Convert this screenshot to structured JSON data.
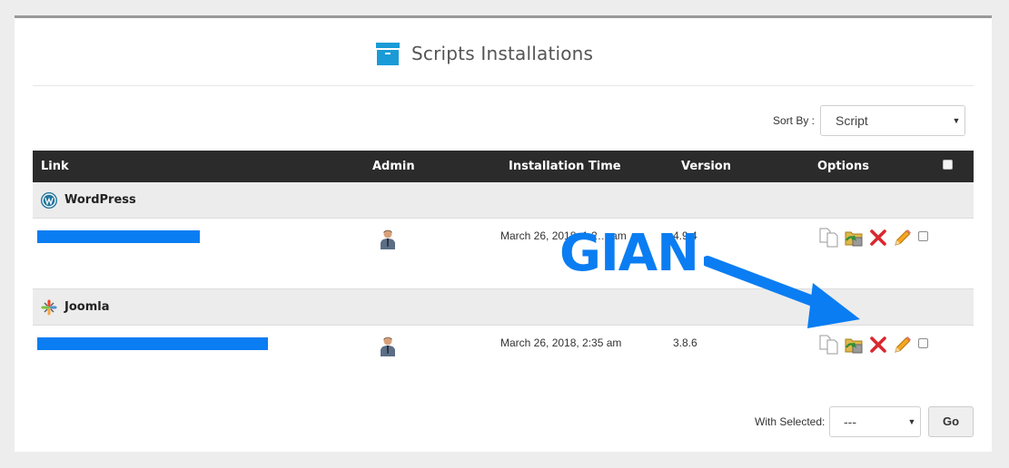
{
  "page": {
    "title": "Scripts Installations",
    "accent_color": "#1a9bd7",
    "header_icon": "archive-box-icon"
  },
  "sort": {
    "label": "Sort By :",
    "selected": "Script"
  },
  "table": {
    "columns": {
      "link": "Link",
      "admin": "Admin",
      "installation_time": "Installation Time",
      "version": "Version",
      "options": "Options"
    },
    "groups": [
      {
        "name": "WordPress",
        "icon": "wordpress-icon",
        "rows": [
          {
            "link": "[redacted]",
            "installation_time": "March 26, 2018, 1:2… am",
            "version": "4.9.4"
          }
        ]
      },
      {
        "name": "Joomla",
        "icon": "joomla-icon",
        "rows": [
          {
            "link": "[redacted]",
            "installation_time": "March 26, 2018, 2:35 am",
            "version": "3.8.6"
          }
        ]
      }
    ],
    "option_icons": [
      "clone-icon",
      "backup-icon",
      "remove-icon",
      "edit-icon"
    ]
  },
  "bulk": {
    "label": "With Selected:",
    "selected": "---",
    "go_label": "Go"
  },
  "overlay": {
    "watermark_text": "GIAN",
    "annotation_color": "#0a7df2"
  }
}
